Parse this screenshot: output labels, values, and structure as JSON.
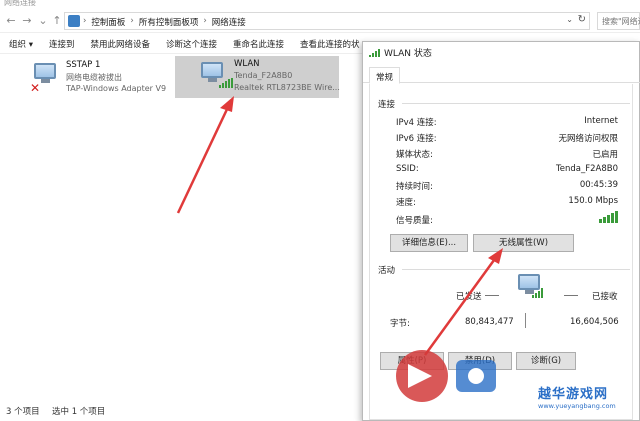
{
  "window": {
    "title": "网络连接"
  },
  "nav": {
    "back": "←",
    "forward": "→",
    "dropdown": "⌄",
    "up": "↑",
    "breadcrumb": [
      "控制面板",
      "所有控制面板项",
      "网络连接"
    ],
    "search_placeholder": "搜索\"网络连接\""
  },
  "commands": [
    "组织 ▾",
    "连接到",
    "禁用此网络设备",
    "诊断这个连接",
    "重命名此连接",
    "查看此连接的状"
  ],
  "connections": [
    {
      "name": "SSTAP 1",
      "status": "网络电缆被拔出",
      "adapter": "TAP-Windows Adapter V9"
    },
    {
      "name": "WLAN",
      "status": "Tenda_F2A8B0",
      "adapter": "Realtek RTL8723BE Wire..."
    }
  ],
  "statusbar": {
    "count": "3 个项目",
    "selected": "选中 1 个项目"
  },
  "dialog": {
    "title": "WLAN 状态",
    "tab": "常规",
    "connection_group": "连接",
    "rows": [
      {
        "k": "IPv4 连接:",
        "v": "Internet"
      },
      {
        "k": "IPv6 连接:",
        "v": "无网络访问权限"
      },
      {
        "k": "媒体状态:",
        "v": "已启用"
      },
      {
        "k": "SSID:",
        "v": "Tenda_F2A8B0"
      },
      {
        "k": "持续时间:",
        "v": "00:45:39"
      },
      {
        "k": "速度:",
        "v": "150.0 Mbps"
      },
      {
        "k": "信号质量:",
        "v": ""
      }
    ],
    "details_button": "详细信息(E)...",
    "wireless_button": "无线属性(W)",
    "activity_group": "活动",
    "sent_label": "已发送",
    "received_label": "已接收",
    "bytes_label": "字节:",
    "bytes_sent": "80,843,477",
    "bytes_received": "16,604,506",
    "bottom_buttons": [
      "属性(P)",
      "禁用(D)",
      "诊断(G)"
    ]
  },
  "watermark": {
    "text": "越华游戏网",
    "url": "www.yueyangbang.com"
  },
  "colors": {
    "selection": "#cfcfcf",
    "signal": "#3a9b3a",
    "arrow": "#e03a3a",
    "watermark": "#2b6fc7"
  }
}
